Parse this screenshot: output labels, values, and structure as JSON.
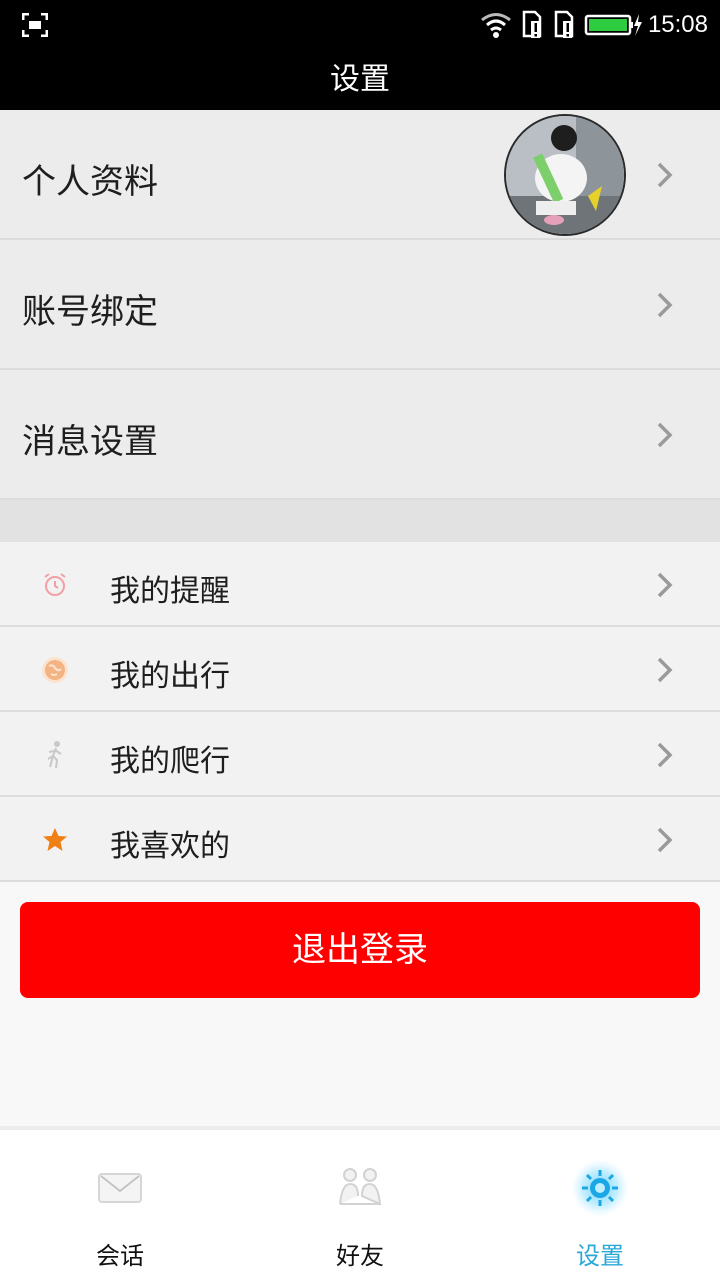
{
  "status_bar": {
    "time": "15:08"
  },
  "header": {
    "title": "设置"
  },
  "profile_section": {
    "items": [
      {
        "label": "个人资料"
      },
      {
        "label": "账号绑定"
      },
      {
        "label": "消息设置"
      }
    ]
  },
  "feature_section": {
    "items": [
      {
        "label": "我的提醒",
        "icon": "alarm-clock-icon"
      },
      {
        "label": "我的出行",
        "icon": "globe-icon"
      },
      {
        "label": "我的爬行",
        "icon": "walking-person-icon"
      },
      {
        "label": "我喜欢的",
        "icon": "star-icon"
      }
    ]
  },
  "logout_button": {
    "label": "退出登录"
  },
  "bottom_tabs": [
    {
      "label": "会话",
      "icon": "envelope-icon"
    },
    {
      "label": "好友",
      "icon": "friends-icon"
    },
    {
      "label": "设置",
      "icon": "sun-gear-icon",
      "active": true
    }
  ],
  "colors": {
    "title_bar": "#000000",
    "logout": "#ff0000",
    "active_tab": "#29a8d8"
  }
}
